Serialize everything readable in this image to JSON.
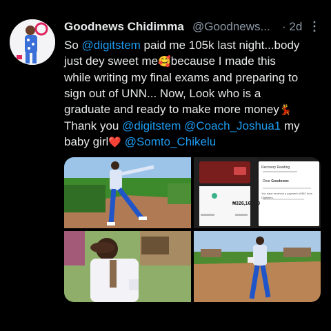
{
  "tweet": {
    "author_name": "Goodnews Chidimma",
    "author_handle": "@Goodnews...",
    "time_sep": "·",
    "time": "2d",
    "more_icon": "more-vertical-icon",
    "lines": [
      [
        {
          "t": "So "
        },
        {
          "t": "@digitstem",
          "m": true
        },
        {
          "t": " paid me 105k last night...body"
        }
      ],
      [
        {
          "t": "just dey sweet me"
        },
        {
          "e": "🥰"
        },
        {
          "t": "because I made this"
        }
      ],
      [
        {
          "t": "while writing my final exams and preparing to"
        }
      ],
      [
        {
          "t": "sign out of UNN... Now, Look who is a"
        }
      ],
      [
        {
          "t": "graduate and ready to make more money"
        },
        {
          "e": "💃"
        }
      ],
      [
        {
          "t": "Thank you "
        },
        {
          "t": "@digitstem",
          "m": true
        },
        {
          "t": " "
        },
        {
          "t": "@Coach_Joshua1",
          "m": true
        },
        {
          "t": "  my"
        }
      ],
      [
        {
          "t": "baby girl"
        },
        {
          "e": "❤️"
        },
        {
          "t": " "
        },
        {
          "t": "@Somto_Chikelu",
          "m": true
        }
      ]
    ]
  },
  "media": {
    "receipt_amount": "₦326,160.00",
    "gmail_title": "Recovery Reading",
    "gmail_greeting": "Dear",
    "gmail_name": "Goodnews",
    "gmail_message": "You have received a payment of $87 from Digitstem."
  },
  "colors": {
    "background": "#000000",
    "text": "#e7e9ea",
    "secondary": "#8b98a5",
    "mention": "#1d9bf0"
  }
}
